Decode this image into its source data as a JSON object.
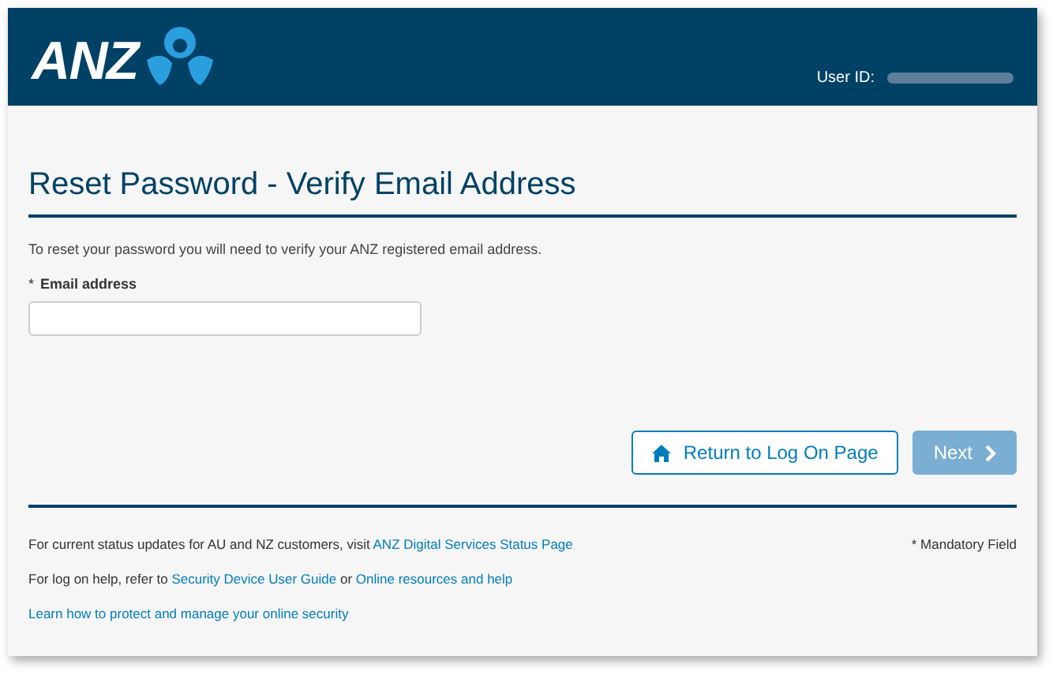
{
  "header": {
    "logo_text": "ANZ",
    "user_id_label": "User ID:",
    "user_id_redacted": true
  },
  "title": "Reset Password - Verify Email Address",
  "intro": "To reset your password you will need to verify your ANZ registered email address.",
  "field": {
    "required_mark": "*",
    "label": "Email address"
  },
  "buttons": [
    {
      "kind": "secondary",
      "label": "Return to Log On Page",
      "disabled": false
    },
    {
      "kind": "primary",
      "label": "Next",
      "disabled": true
    }
  ],
  "footer": {
    "lines": [
      [
        {
          "kind": "text",
          "text": "For current status updates for AU and NZ customers, visit "
        },
        {
          "kind": "link",
          "text": "ANZ Digital Services Status Page"
        }
      ],
      [
        {
          "kind": "text",
          "text": "For log on help, refer to "
        },
        {
          "kind": "link",
          "text": "Security Device User Guide"
        },
        {
          "kind": "text",
          "text": " or "
        },
        {
          "kind": "link",
          "text": "Online resources and help"
        }
      ],
      [
        {
          "kind": "link",
          "text": "Learn how to protect and manage your online security"
        }
      ]
    ],
    "note": "* Mandatory Field"
  }
}
